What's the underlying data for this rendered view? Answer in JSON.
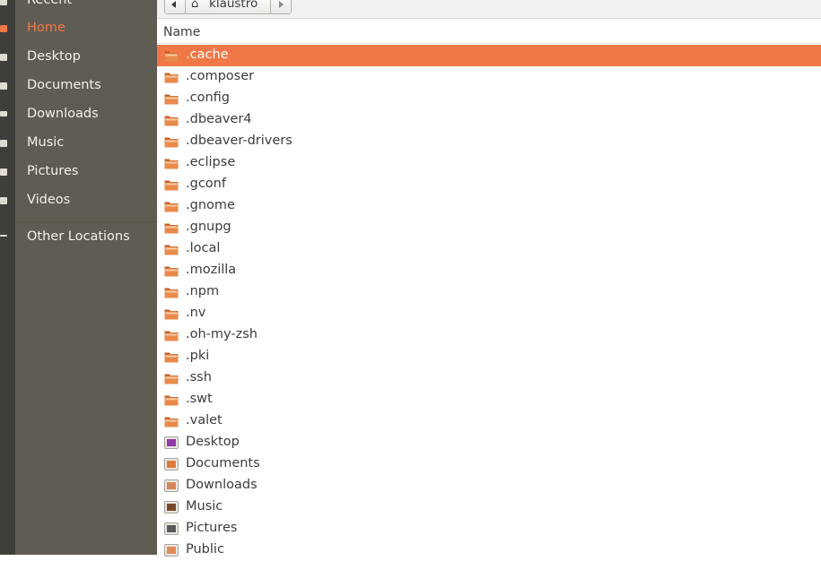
{
  "sidebar": {
    "items": [
      {
        "label": "Recent",
        "icon": "clock-icon",
        "active": false
      },
      {
        "label": "Home",
        "icon": "home-icon",
        "active": true
      },
      {
        "label": "Desktop",
        "icon": "desktop-icon",
        "active": false
      },
      {
        "label": "Documents",
        "icon": "documents-icon",
        "active": false
      },
      {
        "label": "Downloads",
        "icon": "downloads-icon",
        "active": false
      },
      {
        "label": "Music",
        "icon": "music-icon",
        "active": false
      },
      {
        "label": "Pictures",
        "icon": "pictures-icon",
        "active": false
      },
      {
        "label": "Videos",
        "icon": "videos-icon",
        "active": false
      }
    ],
    "other_locations": {
      "label": "Other Locations",
      "icon": "plus-icon"
    }
  },
  "pathbar": {
    "back_icon": "chevron-left-icon",
    "home_icon": "home-icon",
    "current_label": "klaustro",
    "forward_icon": "chevron-right-icon"
  },
  "list": {
    "column_header": "Name",
    "rows": [
      {
        "name": ".cache",
        "icon": "folder-icon",
        "selected": true
      },
      {
        "name": ".composer",
        "icon": "folder-icon"
      },
      {
        "name": ".config",
        "icon": "folder-icon"
      },
      {
        "name": ".dbeaver4",
        "icon": "folder-icon"
      },
      {
        "name": ".dbeaver-drivers",
        "icon": "folder-icon"
      },
      {
        "name": ".eclipse",
        "icon": "folder-icon"
      },
      {
        "name": ".gconf",
        "icon": "folder-icon"
      },
      {
        "name": ".gnome",
        "icon": "folder-icon"
      },
      {
        "name": ".gnupg",
        "icon": "folder-icon"
      },
      {
        "name": ".local",
        "icon": "folder-icon"
      },
      {
        "name": ".mozilla",
        "icon": "folder-icon"
      },
      {
        "name": ".npm",
        "icon": "folder-icon"
      },
      {
        "name": ".nv",
        "icon": "folder-icon"
      },
      {
        "name": ".oh-my-zsh",
        "icon": "folder-icon"
      },
      {
        "name": ".pki",
        "icon": "folder-icon"
      },
      {
        "name": ".ssh",
        "icon": "folder-icon"
      },
      {
        "name": ".swt",
        "icon": "folder-icon"
      },
      {
        "name": ".valet",
        "icon": "folder-icon"
      },
      {
        "name": "Desktop",
        "icon": "desktop-folder-icon"
      },
      {
        "name": "Documents",
        "icon": "documents-folder-icon"
      },
      {
        "name": "Downloads",
        "icon": "downloads-folder-icon"
      },
      {
        "name": "Music",
        "icon": "music-folder-icon"
      },
      {
        "name": "Pictures",
        "icon": "pictures-folder-icon"
      },
      {
        "name": "Public",
        "icon": "public-folder-icon"
      }
    ]
  },
  "colors": {
    "accent": "#f07746",
    "sidebar_bg": "#5f5c54",
    "strip_bg": "#3f3e3a",
    "folder": "#e2783a"
  }
}
